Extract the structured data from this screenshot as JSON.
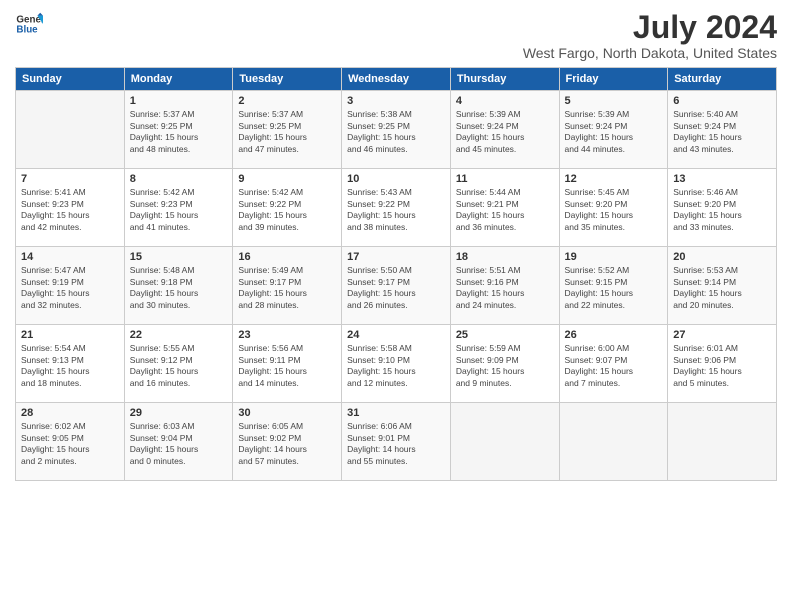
{
  "logo": {
    "line1": "General",
    "line2": "Blue"
  },
  "title": "July 2024",
  "subtitle": "West Fargo, North Dakota, United States",
  "header_days": [
    "Sunday",
    "Monday",
    "Tuesday",
    "Wednesday",
    "Thursday",
    "Friday",
    "Saturday"
  ],
  "weeks": [
    [
      {
        "day": "",
        "info": ""
      },
      {
        "day": "1",
        "info": "Sunrise: 5:37 AM\nSunset: 9:25 PM\nDaylight: 15 hours\nand 48 minutes."
      },
      {
        "day": "2",
        "info": "Sunrise: 5:37 AM\nSunset: 9:25 PM\nDaylight: 15 hours\nand 47 minutes."
      },
      {
        "day": "3",
        "info": "Sunrise: 5:38 AM\nSunset: 9:25 PM\nDaylight: 15 hours\nand 46 minutes."
      },
      {
        "day": "4",
        "info": "Sunrise: 5:39 AM\nSunset: 9:24 PM\nDaylight: 15 hours\nand 45 minutes."
      },
      {
        "day": "5",
        "info": "Sunrise: 5:39 AM\nSunset: 9:24 PM\nDaylight: 15 hours\nand 44 minutes."
      },
      {
        "day": "6",
        "info": "Sunrise: 5:40 AM\nSunset: 9:24 PM\nDaylight: 15 hours\nand 43 minutes."
      }
    ],
    [
      {
        "day": "7",
        "info": "Sunrise: 5:41 AM\nSunset: 9:23 PM\nDaylight: 15 hours\nand 42 minutes."
      },
      {
        "day": "8",
        "info": "Sunrise: 5:42 AM\nSunset: 9:23 PM\nDaylight: 15 hours\nand 41 minutes."
      },
      {
        "day": "9",
        "info": "Sunrise: 5:42 AM\nSunset: 9:22 PM\nDaylight: 15 hours\nand 39 minutes."
      },
      {
        "day": "10",
        "info": "Sunrise: 5:43 AM\nSunset: 9:22 PM\nDaylight: 15 hours\nand 38 minutes."
      },
      {
        "day": "11",
        "info": "Sunrise: 5:44 AM\nSunset: 9:21 PM\nDaylight: 15 hours\nand 36 minutes."
      },
      {
        "day": "12",
        "info": "Sunrise: 5:45 AM\nSunset: 9:20 PM\nDaylight: 15 hours\nand 35 minutes."
      },
      {
        "day": "13",
        "info": "Sunrise: 5:46 AM\nSunset: 9:20 PM\nDaylight: 15 hours\nand 33 minutes."
      }
    ],
    [
      {
        "day": "14",
        "info": "Sunrise: 5:47 AM\nSunset: 9:19 PM\nDaylight: 15 hours\nand 32 minutes."
      },
      {
        "day": "15",
        "info": "Sunrise: 5:48 AM\nSunset: 9:18 PM\nDaylight: 15 hours\nand 30 minutes."
      },
      {
        "day": "16",
        "info": "Sunrise: 5:49 AM\nSunset: 9:17 PM\nDaylight: 15 hours\nand 28 minutes."
      },
      {
        "day": "17",
        "info": "Sunrise: 5:50 AM\nSunset: 9:17 PM\nDaylight: 15 hours\nand 26 minutes."
      },
      {
        "day": "18",
        "info": "Sunrise: 5:51 AM\nSunset: 9:16 PM\nDaylight: 15 hours\nand 24 minutes."
      },
      {
        "day": "19",
        "info": "Sunrise: 5:52 AM\nSunset: 9:15 PM\nDaylight: 15 hours\nand 22 minutes."
      },
      {
        "day": "20",
        "info": "Sunrise: 5:53 AM\nSunset: 9:14 PM\nDaylight: 15 hours\nand 20 minutes."
      }
    ],
    [
      {
        "day": "21",
        "info": "Sunrise: 5:54 AM\nSunset: 9:13 PM\nDaylight: 15 hours\nand 18 minutes."
      },
      {
        "day": "22",
        "info": "Sunrise: 5:55 AM\nSunset: 9:12 PM\nDaylight: 15 hours\nand 16 minutes."
      },
      {
        "day": "23",
        "info": "Sunrise: 5:56 AM\nSunset: 9:11 PM\nDaylight: 15 hours\nand 14 minutes."
      },
      {
        "day": "24",
        "info": "Sunrise: 5:58 AM\nSunset: 9:10 PM\nDaylight: 15 hours\nand 12 minutes."
      },
      {
        "day": "25",
        "info": "Sunrise: 5:59 AM\nSunset: 9:09 PM\nDaylight: 15 hours\nand 9 minutes."
      },
      {
        "day": "26",
        "info": "Sunrise: 6:00 AM\nSunset: 9:07 PM\nDaylight: 15 hours\nand 7 minutes."
      },
      {
        "day": "27",
        "info": "Sunrise: 6:01 AM\nSunset: 9:06 PM\nDaylight: 15 hours\nand 5 minutes."
      }
    ],
    [
      {
        "day": "28",
        "info": "Sunrise: 6:02 AM\nSunset: 9:05 PM\nDaylight: 15 hours\nand 2 minutes."
      },
      {
        "day": "29",
        "info": "Sunrise: 6:03 AM\nSunset: 9:04 PM\nDaylight: 15 hours\nand 0 minutes."
      },
      {
        "day": "30",
        "info": "Sunrise: 6:05 AM\nSunset: 9:02 PM\nDaylight: 14 hours\nand 57 minutes."
      },
      {
        "day": "31",
        "info": "Sunrise: 6:06 AM\nSunset: 9:01 PM\nDaylight: 14 hours\nand 55 minutes."
      },
      {
        "day": "",
        "info": ""
      },
      {
        "day": "",
        "info": ""
      },
      {
        "day": "",
        "info": ""
      }
    ]
  ]
}
